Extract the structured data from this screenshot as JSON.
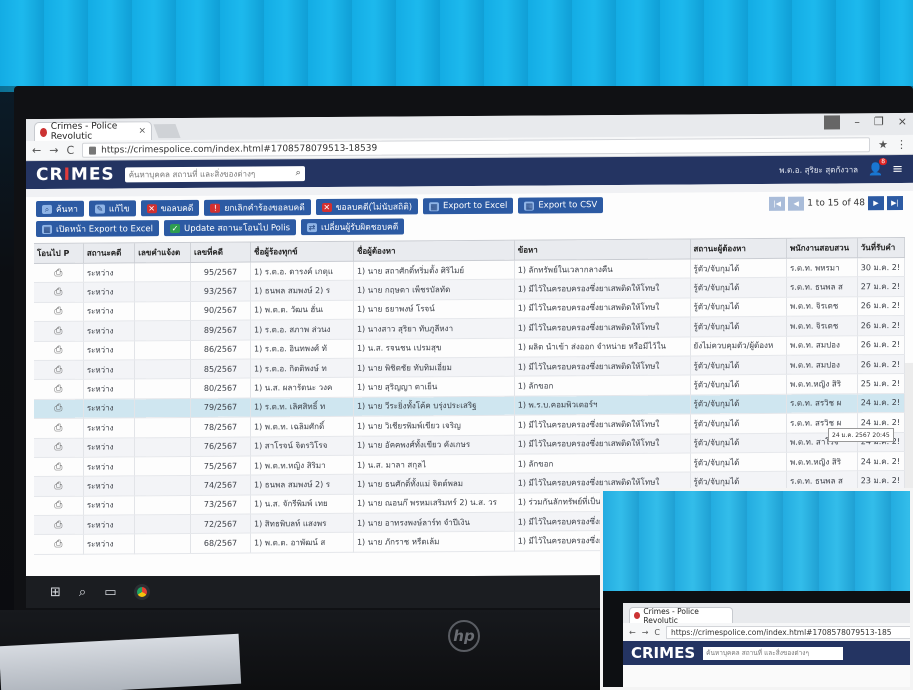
{
  "browser": {
    "tab_title": "Crimes - Police Revolutic",
    "tab_close": "×",
    "url": "https://crimespolice.com/index.html#1708578079513-18539",
    "back": "←",
    "forward": "→",
    "reload": "C",
    "star": "★",
    "more": "⋮",
    "minimize": "–",
    "maximize": "❐",
    "close": "×"
  },
  "app": {
    "brand_prefix": "CR",
    "brand_mid": "I",
    "brand_suffix": "MES",
    "search_placeholder": "ค้นหาบุคคล สถานที่ และสิ่งของต่างๆ",
    "officer_name": "พ.ต.อ. สุริยะ สุดกังวาล",
    "notification_count": "8",
    "accent_color": "#243462"
  },
  "toolbar": {
    "row1": [
      {
        "name": "search-button",
        "label": "ค้นหา",
        "icon": "⌕",
        "style": "blue"
      },
      {
        "name": "edit-button",
        "label": "แก้ไข",
        "icon": "✎",
        "style": "blue"
      },
      {
        "name": "delete-case-button",
        "label": "ขอลบคดี",
        "icon": "✕",
        "style": "red"
      },
      {
        "name": "cancel-delete-request-button",
        "label": "ยกเลิกคำร้องขอลบคดี",
        "icon": "!",
        "style": "red"
      },
      {
        "name": "delete-case-no-stat-button",
        "label": "ขอลบคดี(ไม่นับสถิติ)",
        "icon": "✕",
        "style": "red"
      },
      {
        "name": "export-excel-button",
        "label": "Export to Excel",
        "icon": "▦",
        "style": "blue"
      },
      {
        "name": "export-csv-button",
        "label": "Export to CSV",
        "icon": "▦",
        "style": "blue"
      }
    ],
    "row2": [
      {
        "name": "export-first-page-excel-button",
        "label": "เปิดหน้า Export to Excel",
        "icon": "▦",
        "style": "blue"
      },
      {
        "name": "update-polis-status-button",
        "label": "Update สถานะโอนไป Polis",
        "icon": "✓",
        "style": "green"
      },
      {
        "name": "change-case-officer-button",
        "label": "เปลี่ยนผู้รับผิดชอบคดี",
        "icon": "⇄",
        "style": "blue"
      }
    ],
    "pager": {
      "first": "|◀",
      "prev": "◀",
      "range": "1 to 15 of 48",
      "next": "▶",
      "last": "▶|"
    }
  },
  "table": {
    "headers": [
      "โอนไป P",
      "สถานะคดี",
      "เลขคำแจ้งต",
      "เลขที่คดี",
      "ชื่อผู้ร้องทุกข์",
      "ชื่อผู้ต้องหา",
      "ข้อหา",
      "สถานะผู้ต้องหา",
      "พนักงานสอบสวน",
      "วันที่รับคำ"
    ],
    "rows": [
      [
        "⎙",
        "ระหว่าง",
        "",
        "95/2567",
        "1) ร.ต.อ. ดารงค์ เกตุแ",
        "1) นาย สถาศักดิ์ทริ่มตั้ง ศิริไมย์",
        "1) ลักทรัพย์ในเวลากลางคืน",
        "รู้ตัว/จับกุมได้",
        "ร.ต.ท. พหรมา",
        "30 ม.ค. 2!"
      ],
      [
        "⎙",
        "ระหว่าง",
        "",
        "93/2567",
        "1) ธนพล สมพงษ์ 2) ร",
        "1) นาย กฤษดา เพ็ชรบัลทัด",
        "1) มีไว้ในครอบครองซึ่งยาเสพติดให้โทษใ",
        "รู้ตัว/จับกุมได้",
        "ร.ต.ท. ธนพล ส",
        "27 ม.ค. 2!"
      ],
      [
        "⎙",
        "ระหว่าง",
        "",
        "90/2567",
        "1) พ.ต.ต. วัฒน ฮั่นเ",
        "1) นาย ธยาพงษ์ โรจน์",
        "1) มีไว้ในครอบครองซึ่งยาเสพติดให้โทษใ",
        "รู้ตัว/จับกุมได้",
        "พ.ต.ท. จิรเดช",
        "26 ม.ค. 2!"
      ],
      [
        "⎙",
        "ระหว่าง",
        "",
        "89/2567",
        "1) ร.ต.อ. สภาพ ส่วนง",
        "1) นางสาว สุริยา ทับภูลีหงา",
        "1) มีไว้ในครอบครองซึ่งยาเสพติดให้โทษใ",
        "รู้ตัว/จับกุมได้",
        "พ.ต.ท. จิรเดช",
        "26 ม.ค. 2!"
      ],
      [
        "⎙",
        "ระหว่าง",
        "",
        "86/2567",
        "1) ร.ต.อ. อินทพงศ์ ทั",
        "1) น.ส. รจนชน เปรมสุข",
        "1) ผลิต นำเข้า ส่งออก จำหน่าย หรือมีไว้ใน",
        "ยังไม่ควบคุมตัว/ผู้ต้องห",
        "พ.ต.ท. สมปอง",
        "26 ม.ค. 2!"
      ],
      [
        "⎙",
        "ระหว่าง",
        "",
        "85/2567",
        "1) ร.ต.อ. กิตติพงษ์ ท",
        "1) นาย พิชิตชัย ทับทิมเอี่ยม",
        "1) มีไว้ในครอบครองซึ่งยาเสพติดให้โทษใ",
        "รู้ตัว/จับกุมได้",
        "พ.ต.ท. สมปอง",
        "26 ม.ค. 2!"
      ],
      [
        "⎙",
        "ระหว่าง",
        "",
        "80/2567",
        "1) น.ส. ผลารัตนะ วงค",
        "1) นาย สุริญญา ตาเย็น",
        "1) ลักขอก",
        "รู้ตัว/จับกุมได้",
        "พ.ต.ท.หญิง สิริ",
        "25 ม.ค. 2!"
      ],
      [
        "⎙",
        "ระหว่าง",
        "",
        "79/2567",
        "1) ร.ต.ท. เลิศสิทธิ์ ท",
        "1) นาย วีระยิ่งทั้งโค้ค บรุ่งประเสริฐ",
        "1) พ.ร.บ.คอมพิวเตอร์ฯ",
        "รู้ตัว/จับกุมได้",
        "ร.ต.ท. สรวิช ผ",
        "24 ม.ค. 2!"
      ],
      [
        "⎙",
        "ระหว่าง",
        "",
        "78/2567",
        "1) พ.ต.ท. เฉลิมศักดิ์",
        "1) นาย วิเชียรพิมพ์เขียว เจริญ",
        "1) มีไว้ในครอบครองซึ่งยาเสพติดให้โทษใ",
        "รู้ตัว/จับกุมได้",
        "ร.ต.ท. สรวิช ผ",
        "24 ม.ค. 2!"
      ],
      [
        "⎙",
        "ระหว่าง",
        "",
        "76/2567",
        "1) สาโรจน์ จิตรวิโรจ",
        "1) นาย อัคคพงศ์ทั้งเขียว คังเกษร",
        "1) มีไว้ในครอบครองซึ่งยาเสพติดให้โทษใ",
        "รู้ตัว/จับกุมได้",
        "พ.ต.ท. สาโรจ",
        "24 ม.ค. 2!"
      ],
      [
        "⎙",
        "ระหว่าง",
        "",
        "75/2567",
        "1) พ.ต.ท.หญิง สิริมา",
        "1) น.ส. มาลา สกุลไ",
        "1) ลักขอก",
        "รู้ตัว/จับกุมได้",
        "พ.ต.ท.หญิง สิริ",
        "24 ม.ค. 2!"
      ],
      [
        "⎙",
        "ระหว่าง",
        "",
        "74/2567",
        "1) ธนพล สมพงษ์ 2) ร",
        "1) นาย ธนศักดิ์ทั้งแม่ จิตต์พลม",
        "1) มีไว้ในครอบครองซึ่งยาเสพติดให้โทษใ",
        "รู้ตัว/จับกุมได้",
        "ร.ต.ท. ธนพล ส",
        "23 ม.ค. 2!"
      ],
      [
        "⎙",
        "ระหว่าง",
        "",
        "73/2567",
        "1) น.ส. จักรีพิมพ์ เทย",
        "1) นาย ณอนก๊ พรหมเสริมทร์ 2) น.ส. วร",
        "1) ร่วมกันลักทรัพย์ที่เป็นของ",
        "",
        "",
        ""
      ],
      [
        "⎙",
        "ระหว่าง",
        "",
        "72/2567",
        "1) สิทธพิบลท์ แสงพร",
        "1) นาย อาทรงพงษ์ลาร์ท จำปีเงิน",
        "1) มีไว้ในครอบครองซึ่งยาเสพ",
        "",
        "",
        ""
      ],
      [
        "⎙",
        "ระหว่าง",
        "",
        "68/2567",
        "1) พ.ต.ต. อาพัฒน์ ส",
        "1) นาย ภักราช หรืดเล้ม",
        "1) มีไว้ในครอบครองซึ่งยาเสพ",
        "",
        "",
        ""
      ]
    ],
    "selected_row": 7,
    "tooltip": "24 ม.ค. 2567 20:45"
  },
  "taskbar": {
    "start": "⊞",
    "search": "⌕",
    "taskview": "▭"
  },
  "monitor_brand": "hp",
  "reflection": {
    "tab_title": "Crimes - Police Revolutic",
    "url": "https://crimespolice.com/index.html#1708578079513-185",
    "brand": "CRIMES",
    "search_placeholder": "ค้นหาบุคคล สถานที่ และสิ่งของต่างๆ"
  }
}
